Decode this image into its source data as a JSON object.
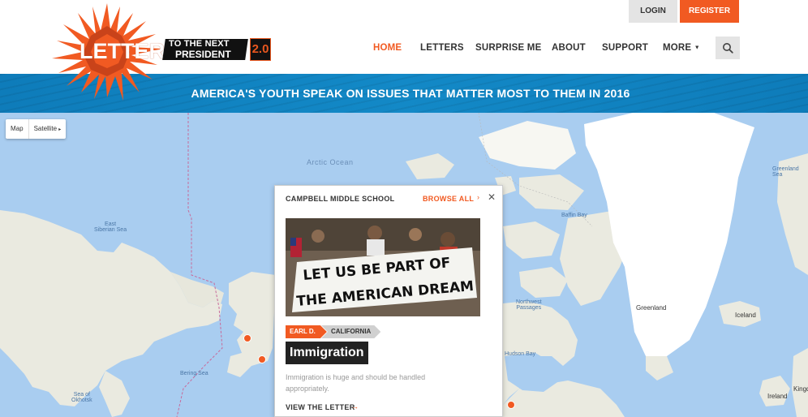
{
  "logo": {
    "word": "LETTERS",
    "line1": "TO THE NEXT",
    "line2": "PRESIDENT",
    "version": "2.0"
  },
  "auth": {
    "login": "LOGIN",
    "register": "REGISTER"
  },
  "nav": {
    "items": [
      "HOME",
      "LETTERS",
      "SURPRISE ME",
      "ABOUT",
      "SUPPORT",
      "MORE"
    ],
    "active": "HOME"
  },
  "banner": {
    "text": "AMERICA'S YOUTH SPEAK ON ISSUES THAT MATTER MOST TO THEM IN 2016"
  },
  "map": {
    "type_controls": [
      "Map",
      "Satellite"
    ],
    "labels": {
      "arctic_ocean": "Arctic Ocean",
      "east_siberian_sea": "East\nSiberian Sea",
      "baffin_bay": "Baffin Bay",
      "greenland_sea": "Greenland Sea",
      "greenland": "Greenland",
      "iceland": "Iceland",
      "bering_sea": "Bering Sea",
      "sea_of_okhotsk": "Sea of\nOkhotsk",
      "hudson_bay": "Hudson Bay",
      "northwest_passages": "Northwest\nPassages",
      "ireland": "Ireland",
      "kingdom": "Kingd"
    }
  },
  "popup": {
    "school": "CAMPBELL MIDDLE SCHOOL",
    "browse": "BROWSE ALL",
    "author": "EARL D.",
    "state": "CALIFORNIA",
    "topic": "Immigration",
    "description": "Immigration is huge and should be handled appropriately.",
    "view": "VIEW THE LETTER",
    "photo_sign": [
      "LET US BE PART OF",
      "THE AMERICAN DREAM"
    ]
  },
  "colors": {
    "accent": "#f15a22",
    "banner": "#0e7cba",
    "water": "#a9cdf0",
    "land": "#eaeae0",
    "ice": "#ffffff"
  }
}
